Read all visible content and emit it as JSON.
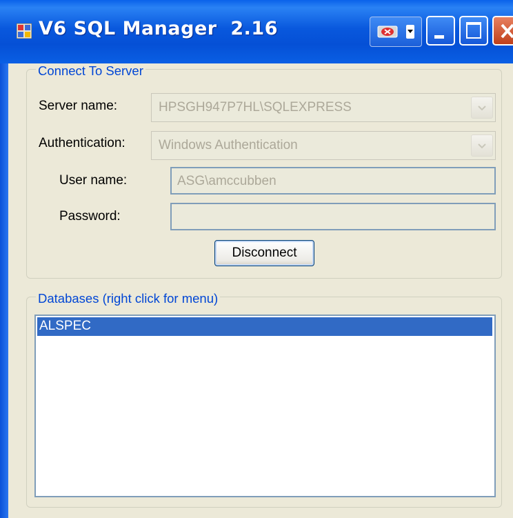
{
  "window": {
    "title": "V6 SQL Manager  2.16",
    "icons": {
      "app": "app-icon",
      "extra": "red-x-cd-icon",
      "minimize": "minimize-icon",
      "maximize": "maximize-icon",
      "close": "close-icon"
    }
  },
  "connect": {
    "legend": "Connect To Server",
    "server_label": "Server name:",
    "server_value": "HPSGH947P7HL\\SQLEXPRESS",
    "auth_label": "Authentication:",
    "auth_value": "Windows Authentication",
    "user_label": "User name:",
    "user_value": "ASG\\amccubben",
    "password_label": "Password:",
    "password_value": "",
    "disconnect_label": "Disconnect"
  },
  "databases": {
    "legend": "Databases (right click for menu)",
    "items": [
      "ALSPEC"
    ],
    "selected": "ALSPEC"
  },
  "colors": {
    "titlebar": "#0a5fe4",
    "client": "#ece9d8",
    "legend": "#0046d5",
    "selection": "#316ac5",
    "disabled_text": "#aca899"
  }
}
